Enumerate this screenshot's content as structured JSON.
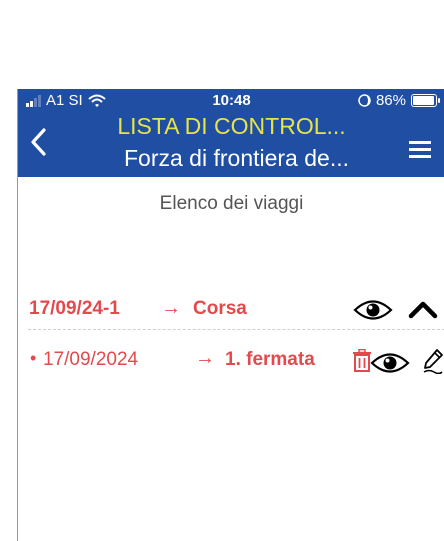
{
  "status": {
    "carrier": "A1 SI",
    "time": "10:48",
    "battery_percent": "86%",
    "battery_level": 0.86
  },
  "header": {
    "title": "LISTA DI CONTROL...",
    "subtitle": "Forza di frontiera de..."
  },
  "page": {
    "heading": "Elenco dei viaggi"
  },
  "trips": [
    {
      "id": "17/09/24-1",
      "arrow": "→",
      "type": "Corsa",
      "stops": [
        {
          "bullet": "•",
          "date": "17/09/2024",
          "arrow": "→",
          "name": "1. fermata"
        }
      ]
    }
  ],
  "colors": {
    "header_bg": "#1f4ea3",
    "title_yellow": "#e7e34a",
    "accent_red": "#e34a4d"
  },
  "icons": [
    "wifi-icon",
    "moon-icon",
    "battery-icon",
    "back-arrow-icon",
    "menu-icon",
    "eye-icon",
    "chevron-up-icon",
    "trash-icon",
    "pencil-icon"
  ]
}
